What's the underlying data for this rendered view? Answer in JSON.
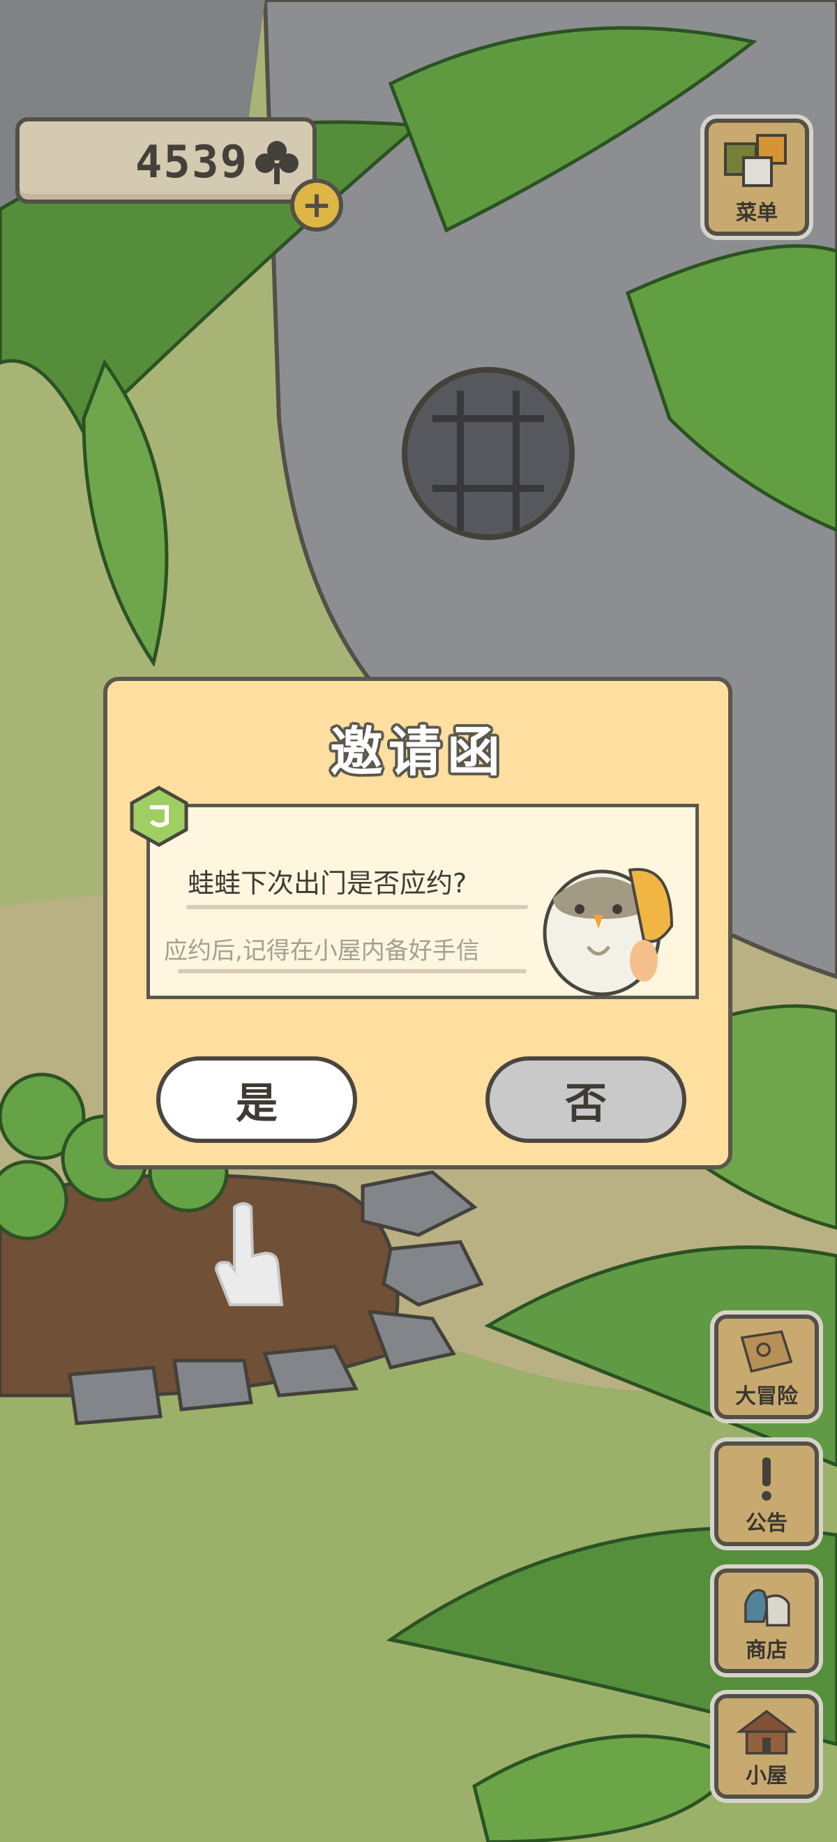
{
  "currency": {
    "value": "4539",
    "icon": "clover-icon",
    "add_icon": "plus-icon"
  },
  "menu_button": {
    "label": "菜单"
  },
  "side_buttons": [
    {
      "label": "大冒险",
      "icon": "map-icon"
    },
    {
      "label": "公告",
      "icon": "exclamation-icon"
    },
    {
      "label": "商店",
      "icon": "bag-icon"
    },
    {
      "label": "小屋",
      "icon": "house-icon"
    }
  ],
  "dialog": {
    "title": "邀请函",
    "question": "蛙蛙下次出门是否应约?",
    "hint": "应约后,记得在小屋内备好手信",
    "yes_label": "是",
    "no_label": "否"
  },
  "colors": {
    "dialog_bg": "#ffdf9f",
    "card_bg": "#fff6df",
    "button_yes": "#ffffff",
    "button_no": "#c9c9c9",
    "outline": "#5a574e"
  }
}
